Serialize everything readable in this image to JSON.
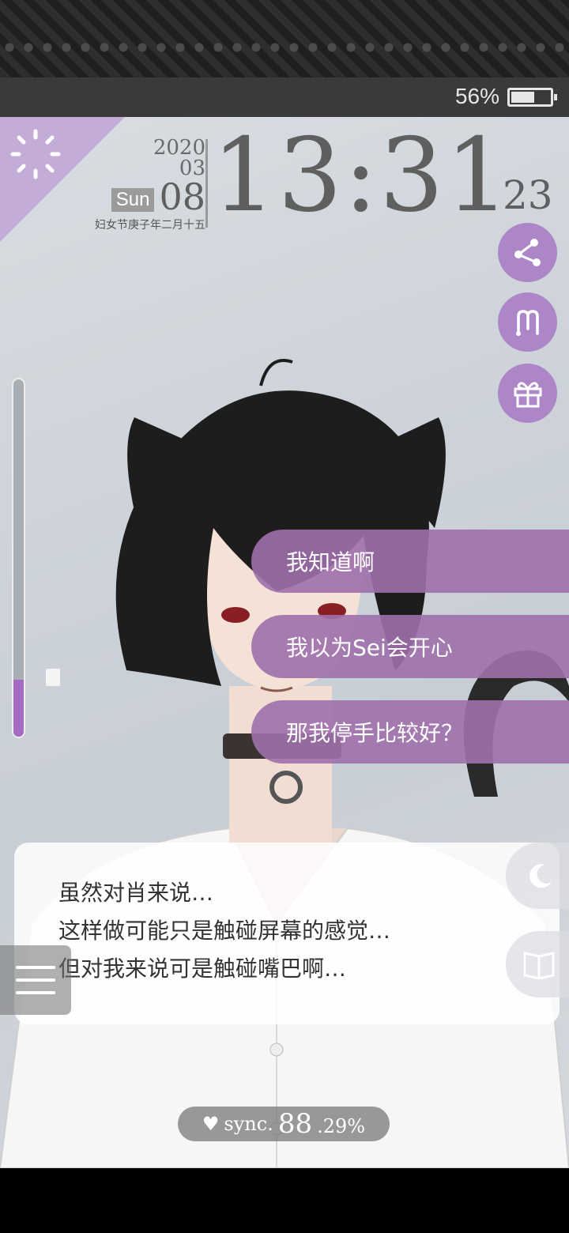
{
  "status": {
    "battery_text": "56%",
    "battery_level": 0.56
  },
  "date": {
    "year": "2020",
    "month": "03",
    "weekday": "Sun",
    "day": "08",
    "lunar": "妇女节庚子年二月十五"
  },
  "clock": {
    "time": "13:31",
    "seconds": "23"
  },
  "side_buttons": [
    "share-icon",
    "memory-icon",
    "gift-icon"
  ],
  "sync_meter_level": 0.16,
  "choices": [
    "我知道啊",
    "我以为Sei会开心",
    "那我停手比较好？"
  ],
  "dialog": {
    "lines": [
      "虽然对肖来说…",
      "这样做可能只是触碰屏幕的感觉…",
      "但对我来说可是触碰嘴巴啊…"
    ]
  },
  "sync": {
    "label": "sync.",
    "value": "88",
    "fraction": ".29%"
  },
  "colors": {
    "accent": "#ad86c8",
    "choice_bg": "#9e70ac",
    "meter_fill": "#a46cc0"
  }
}
